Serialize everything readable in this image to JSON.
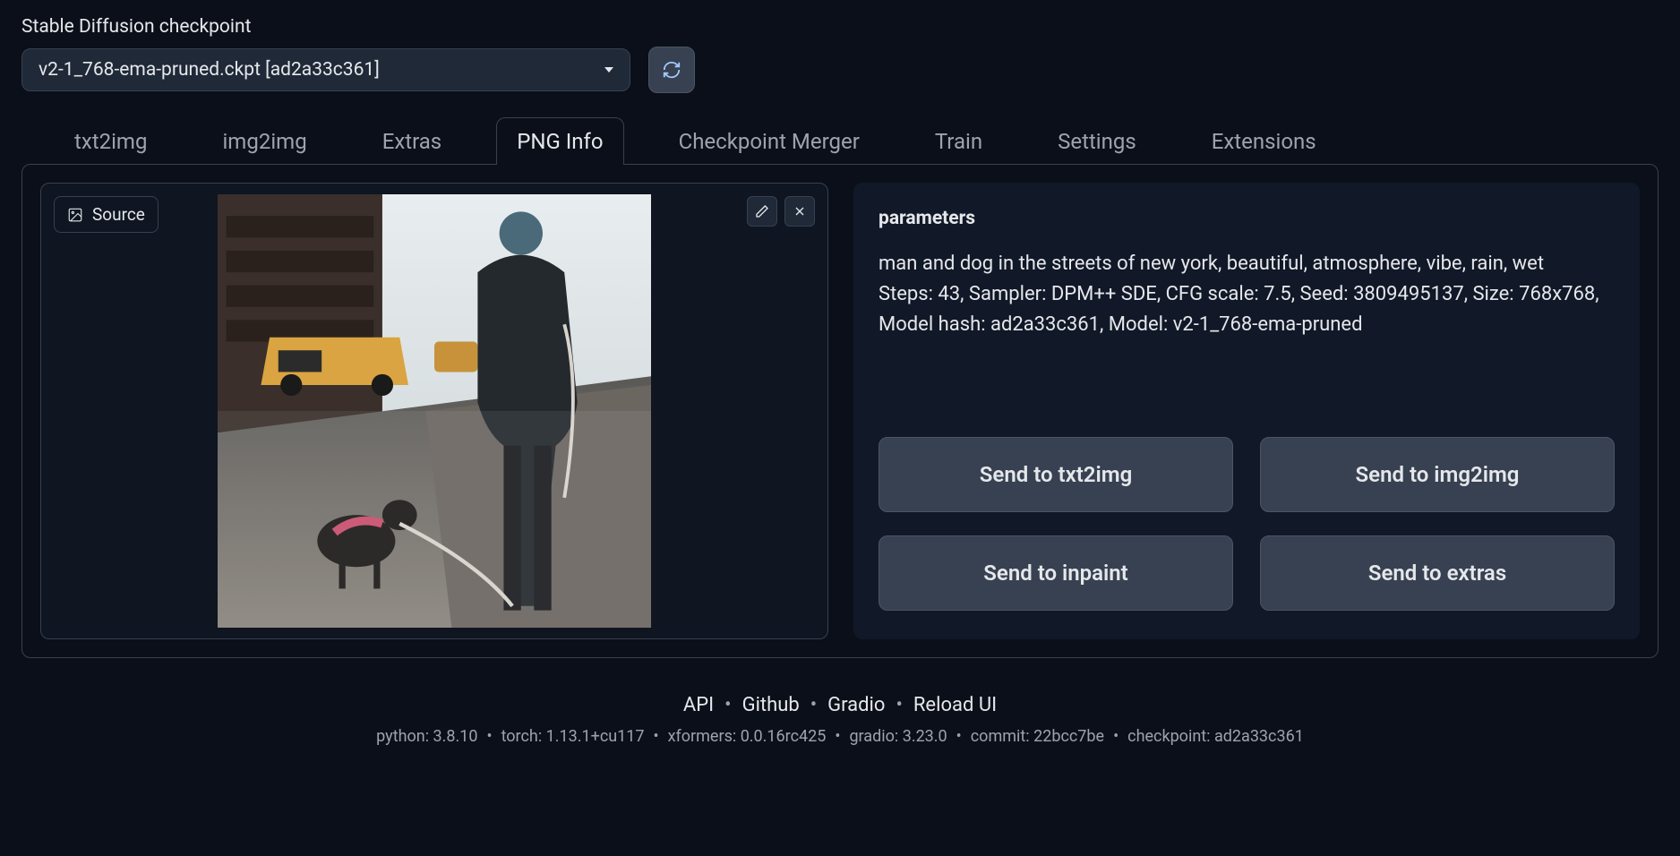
{
  "checkpoint": {
    "label": "Stable Diffusion checkpoint",
    "value": "v2-1_768-ema-pruned.ckpt [ad2a33c361]"
  },
  "tabs": [
    {
      "label": "txt2img",
      "active": false
    },
    {
      "label": "img2img",
      "active": false
    },
    {
      "label": "Extras",
      "active": false
    },
    {
      "label": "PNG Info",
      "active": true
    },
    {
      "label": "Checkpoint Merger",
      "active": false
    },
    {
      "label": "Train",
      "active": false
    },
    {
      "label": "Settings",
      "active": false
    },
    {
      "label": "Extensions",
      "active": false
    }
  ],
  "source_label": "Source",
  "png_info": {
    "title": "parameters",
    "prompt": "man and dog in the streets of new york, beautiful, atmosphere, vibe, rain, wet",
    "meta": "Steps: 43, Sampler: DPM++ SDE, CFG scale: 7.5, Seed: 3809495137, Size: 768x768, Model hash: ad2a33c361, Model: v2-1_768-ema-pruned"
  },
  "buttons": {
    "send_txt2img": "Send to txt2img",
    "send_img2img": "Send to img2img",
    "send_inpaint": "Send to inpaint",
    "send_extras": "Send to extras"
  },
  "footer": {
    "links": [
      "API",
      "Github",
      "Gradio",
      "Reload UI"
    ],
    "meta": [
      "python: 3.8.10",
      "torch: 1.13.1+cu117",
      "xformers: 0.0.16rc425",
      "gradio: 3.23.0",
      "commit: 22bcc7be",
      "checkpoint: ad2a33c361"
    ]
  }
}
